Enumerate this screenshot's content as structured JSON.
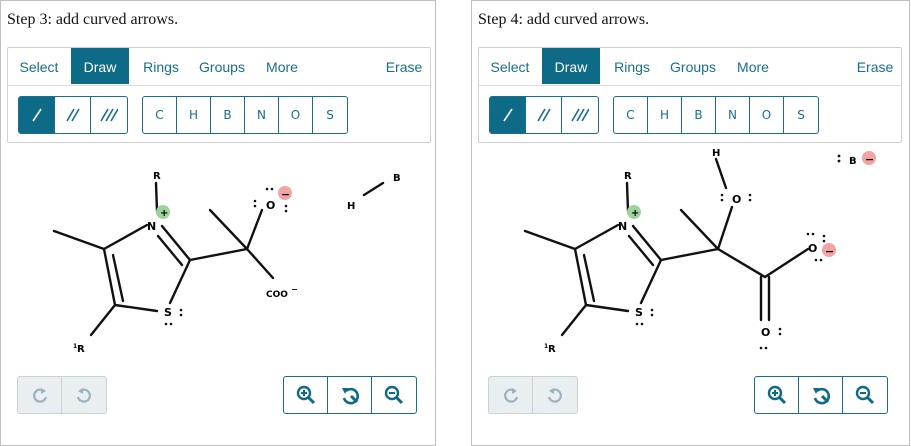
{
  "left": {
    "title": "Step 3: add curved arrows.",
    "menu": {
      "select": "Select",
      "draw": "Draw",
      "rings": "Rings",
      "groups": "Groups",
      "more": "More",
      "erase": "Erase"
    },
    "atoms": [
      "C",
      "H",
      "B",
      "N",
      "O",
      "S"
    ],
    "labels": {
      "R": "R",
      "N": "N",
      "S": "S",
      "O": "O",
      "R1": "R",
      "R1_sup": "1",
      "COO": "COO",
      "minus": "−",
      "H": "H",
      "B": "B",
      "plus": "+",
      "neg": "−"
    }
  },
  "right": {
    "title": "Step 4: add curved arrows.",
    "menu": {
      "select": "Select",
      "draw": "Draw",
      "rings": "Rings",
      "groups": "Groups",
      "more": "More",
      "erase": "Erase"
    },
    "atoms": [
      "C",
      "H",
      "B",
      "N",
      "O",
      "S"
    ],
    "labels": {
      "R": "R",
      "N": "N",
      "S": "S",
      "O1": "O",
      "O2": "O",
      "O3": "O",
      "H": "H",
      "B": "B",
      "R1": "R",
      "R1_sup": "1",
      "plus": "+",
      "neg": "−"
    }
  },
  "colors": {
    "accent": "#0e6b87",
    "positive": "#9ed39e",
    "negative": "#f2a3a3"
  },
  "icons": [
    "single-bond-icon",
    "double-bond-icon",
    "triple-bond-icon",
    "redo-icon",
    "undo-icon",
    "zoom-in-icon",
    "reset-view-icon",
    "zoom-out-icon"
  ]
}
